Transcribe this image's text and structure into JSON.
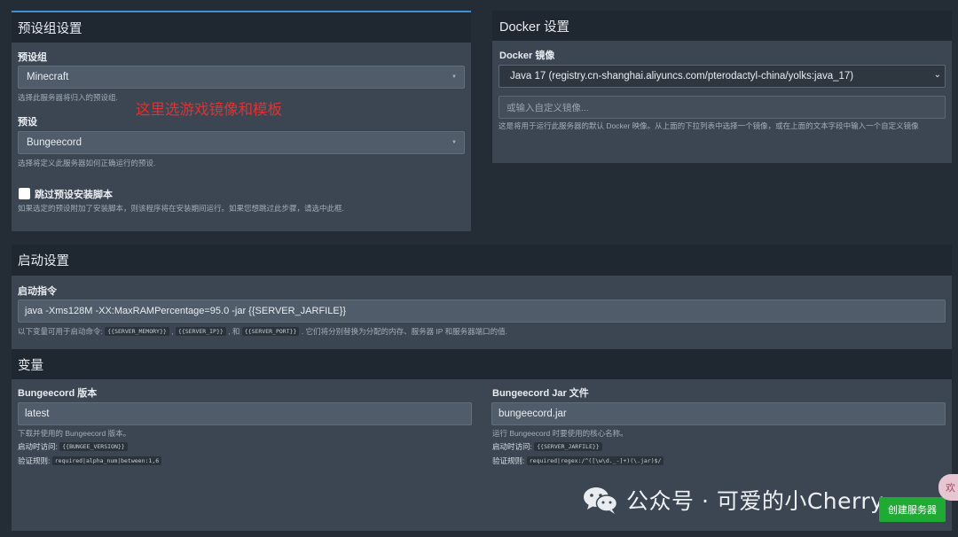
{
  "preset_group_box": {
    "title": "预设组设置",
    "nest_label": "预设组",
    "nest_value": "Minecraft",
    "nest_help": "选择此服务器将归入的预设组.",
    "annotation": "这里选游戏镜像和模板",
    "egg_label": "预设",
    "egg_value": "Bungeecord",
    "egg_help": "选择将定义此服务器如何正确运行的预设.",
    "skip_label": "跳过预设安装脚本",
    "skip_help": "如果选定的预设附加了安装脚本，则该程序将在安装期间运行。如果您想跳过此步骤，请选中此框."
  },
  "docker_box": {
    "title": "Docker 设置",
    "image_label": "Docker 镜像",
    "image_value": "Java 17 (registry.cn-shanghai.aliyuncs.com/pterodactyl-china/yolks:java_17)",
    "custom_placeholder": "或输入自定义镜像...",
    "help": "这是将用于运行此服务器的默认 Docker 映像。从上面的下拉列表中选择一个镜像，或在上面的文本字段中输入一个自定义镜像"
  },
  "startup_box": {
    "title": "启动设置",
    "command_label": "启动指令",
    "command_value": "java -Xms128M -XX:MaxRAMPercentage=95.0 -jar {{SERVER_JARFILE}}",
    "help_prefix": "以下变量可用于启动命令:",
    "var_memory": "{{SERVER_MEMORY}}",
    "sep1": ",",
    "var_ip": "{{SERVER_IP}}",
    "sep2": ", 和",
    "var_port": "{{SERVER_PORT}}",
    "help_suffix": ". 它们将分别替换为分配的内存、服务器 IP 和服务器端口的值."
  },
  "variables_box": {
    "title": "变量",
    "version": {
      "label": "Bungeecord 版本",
      "value": "latest",
      "help": "下载并使用的 Bungeecord 版本。",
      "access_label": "启动时访问:",
      "access_var": "{{BUNGEE_VERSION}}",
      "rules_label": "验证规则:",
      "rules_value": "required|alpha_num|between:1,6"
    },
    "jar": {
      "label": "Bungeecord Jar 文件",
      "value": "bungeecord.jar",
      "help": "运行 Bungeecord 时要使用的核心名称。",
      "access_label": "启动时访问:",
      "access_var": "{{SERVER_JARFILE}}",
      "rules_label": "验证规则:",
      "rules_value": "required|regex:/^([\\w\\d._-]+)(\\.jar)$/"
    }
  },
  "watermark": {
    "text": "公众号 · 可爱的小Cherry",
    "badge": "欢"
  },
  "create_button": {
    "label": "创建服务器"
  },
  "colors": {
    "accent_green": "#1faa34",
    "annotation_red": "#e03232",
    "top_border": "#3d8fd1"
  }
}
